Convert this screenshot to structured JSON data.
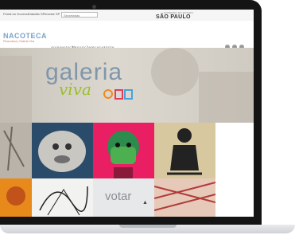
{
  "gov_bar": {
    "links": [
      "Portal do Governo",
      "Cidadão SP",
      "Investe SP"
    ],
    "select_value": "Secretarias",
    "logo_small": "GOVERNO DO ESTADO",
    "logo_big": "SÃO PAULO"
  },
  "header": {
    "logo_text": "NACOTECA",
    "logo_sub": "Pinacoteca | Galeria Viva",
    "nav": [
      "Apresentação",
      "Exposições",
      "Acervo",
      "Visite"
    ]
  },
  "hero": {
    "title": "galeria",
    "subtitle": "viva"
  },
  "gallery": {
    "votar_label": "votar"
  },
  "colors": {
    "title": "#7f96ab",
    "subtitle": "#9bbd2e"
  }
}
